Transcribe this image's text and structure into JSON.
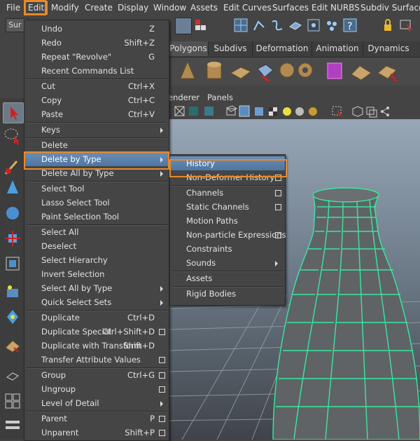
{
  "menubar": [
    "File",
    "Edit",
    "Modify",
    "Create",
    "Display",
    "Window",
    "Assets",
    "Edit Curves",
    "Surfaces",
    "Edit NURBS",
    "Subdiv Surfaces"
  ],
  "mode_field": "Sur",
  "shelf_tabs": [
    "Polygons",
    "Subdivs",
    "Deformation",
    "Animation",
    "Dynamics"
  ],
  "panel_menu": [
    "enderer",
    "Panels"
  ],
  "edit_menu": [
    {
      "label": "Undo",
      "shortcut": "Z"
    },
    {
      "label": "Redo",
      "shortcut": "Shift+Z"
    },
    {
      "label": "Repeat \"Revolve\"",
      "shortcut": "G"
    },
    {
      "label": "Recent Commands List"
    },
    {
      "sep": true
    },
    {
      "label": "Cut",
      "shortcut": "Ctrl+X"
    },
    {
      "label": "Copy",
      "shortcut": "Ctrl+C"
    },
    {
      "label": "Paste",
      "shortcut": "Ctrl+V"
    },
    {
      "sep": true
    },
    {
      "label": "Keys",
      "submenu": true
    },
    {
      "sep": true
    },
    {
      "label": "Delete"
    },
    {
      "label": "Delete by Type",
      "submenu": true,
      "highlight": true
    },
    {
      "label": "Delete All by Type",
      "submenu": true
    },
    {
      "sep": true
    },
    {
      "label": "Select Tool"
    },
    {
      "label": "Lasso Select Tool"
    },
    {
      "label": "Paint Selection Tool"
    },
    {
      "sep": true
    },
    {
      "label": "Select All"
    },
    {
      "label": "Deselect"
    },
    {
      "label": "Select Hierarchy"
    },
    {
      "label": "Invert Selection"
    },
    {
      "label": "Select All by Type",
      "submenu": true
    },
    {
      "label": "Quick Select Sets",
      "submenu": true
    },
    {
      "sep": true
    },
    {
      "label": "Duplicate",
      "shortcut": "Ctrl+D"
    },
    {
      "label": "Duplicate Special",
      "shortcut": "Ctrl+Shift+D",
      "option": true
    },
    {
      "label": "Duplicate with Transform",
      "shortcut": "Shift+D"
    },
    {
      "label": "Transfer Attribute Values",
      "option": true
    },
    {
      "sep": true
    },
    {
      "label": "Group",
      "shortcut": "Ctrl+G",
      "option": true
    },
    {
      "label": "Ungroup",
      "option": true
    },
    {
      "label": "Level of Detail",
      "submenu": true
    },
    {
      "sep": true
    },
    {
      "label": "Parent",
      "shortcut": "P",
      "option": true
    },
    {
      "label": "Unparent",
      "shortcut": "Shift+P",
      "option": true
    }
  ],
  "delete_by_type_menu": [
    {
      "label": "History",
      "highlight": true
    },
    {
      "label": "Non-Deformer History",
      "option": true
    },
    {
      "sep": true
    },
    {
      "label": "Channels",
      "option": true
    },
    {
      "label": "Static Channels",
      "option": true
    },
    {
      "label": "Motion Paths"
    },
    {
      "label": "Non-particle Expressions",
      "option": true
    },
    {
      "label": "Constraints"
    },
    {
      "label": "Sounds",
      "submenu": true
    },
    {
      "sep": true
    },
    {
      "label": "Assets"
    },
    {
      "sep": true
    },
    {
      "label": "Rigid Bodies"
    }
  ],
  "colors": {
    "highlight": "#5a80aa",
    "callout": "#e8892b",
    "wireframe": "#39e8a0",
    "menu_bg": "#454545"
  }
}
